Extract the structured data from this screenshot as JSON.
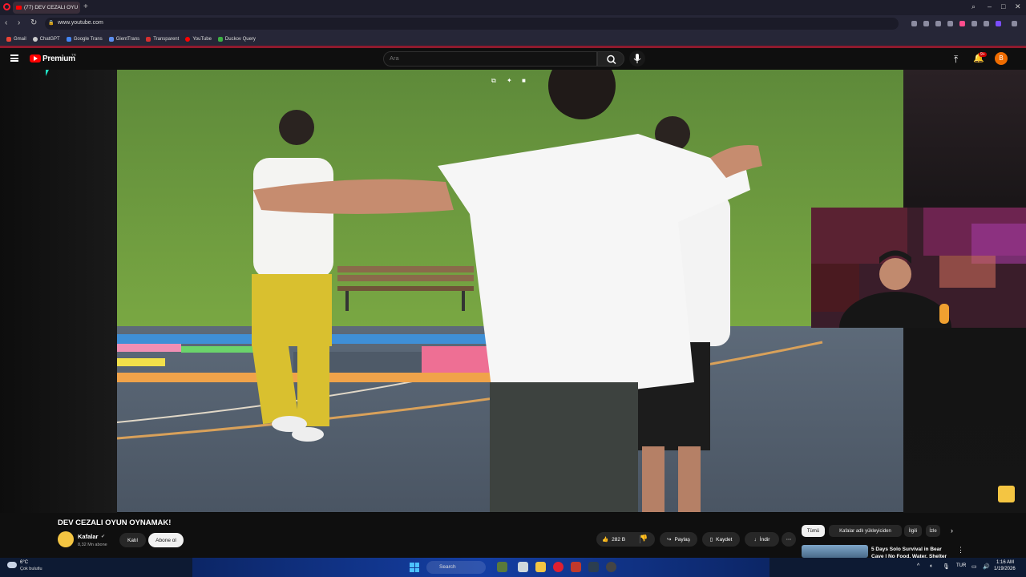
{
  "browser": {
    "tab_title": "(77) DEV CEZALI OYU",
    "url": "www.youtube.com",
    "new_tab": "+",
    "bookmarks": [
      "Gmail",
      "ChatGPT",
      "Google Trans",
      "GientTrans",
      "Transparent",
      "YouTube",
      "Duckov Query"
    ]
  },
  "youtube": {
    "logo_text": "Premium",
    "country_code": "TR",
    "search_placeholder": "Ara",
    "notification_badge": "9+",
    "avatar_letter": "B"
  },
  "video": {
    "title": "DEV CEZALI OYUN OYNAMAK!",
    "channel": "Kafalar",
    "subscribers": "8,32 Mn abone",
    "join_label": "Katıl",
    "subscribe_label": "Abone ol",
    "likes": "282 B",
    "share_label": "Paylaş",
    "save_label": "Kaydet",
    "download_label": "İndir"
  },
  "sidebar_chips": [
    "Tümü",
    "Kafalar adlı yükleyiciden",
    "İlgili",
    "İzle"
  ],
  "recommendation": {
    "title": "5 Days Solo Survival in Bear Cave | No Food, Water, Shelter"
  },
  "taskbar": {
    "weather_temp": "6°C",
    "weather_desc": "Çok bulutlu",
    "search_label": "Search",
    "lang": "TUR",
    "time": "1:16 AM",
    "date": "1/19/2026"
  },
  "colors": {
    "youtube_red": "#ff0000",
    "background": "#0f0f0f",
    "button_bg": "#272727",
    "subscribe_bg": "#f1f1f1"
  }
}
